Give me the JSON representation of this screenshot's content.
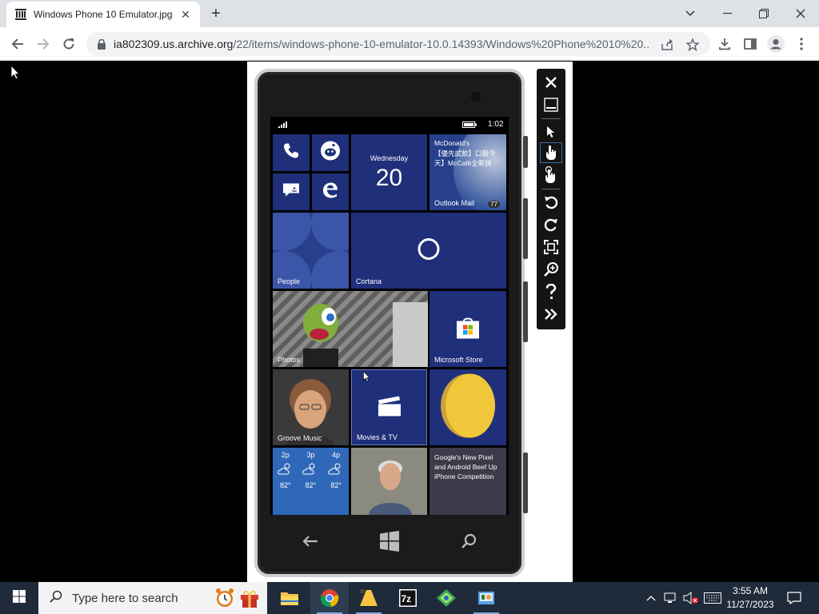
{
  "browser": {
    "tab_title": "Windows Phone 10 Emulator.jpg",
    "tab_close": "✕",
    "new_tab": "+",
    "url_host": "ia802309.us.archive.org",
    "url_path": "/22/items/windows-phone-10-emulator-10.0.14393/Windows%20Phone%2010%20..."
  },
  "phone": {
    "status_time": "1:02",
    "tiles": {
      "calendar_day": "Wednesday",
      "calendar_date": "20",
      "outlook_line1": "McDonald's",
      "outlook_line2": "【優先試飲】口服今",
      "outlook_line3": "天】McCafé全新抹",
      "outlook_label": "Outlook Mail",
      "outlook_badge": "77",
      "people_label": "People",
      "cortana_label": "Cortana",
      "photos_label": "Photos",
      "store_label": "Microsoft Store",
      "groove_label": "Groove Music",
      "movies_label": "Movies & TV",
      "weather_hours": [
        "2p",
        "3p",
        "4p"
      ],
      "weather_temps": [
        "82°",
        "82°",
        "82°"
      ],
      "news_headline": "Google's New Pixel and Android Beef Up iPhone Competition"
    }
  },
  "taskbar": {
    "search_placeholder": "Type here to search",
    "time": "3:55 AM",
    "date": "11/27/2023"
  }
}
